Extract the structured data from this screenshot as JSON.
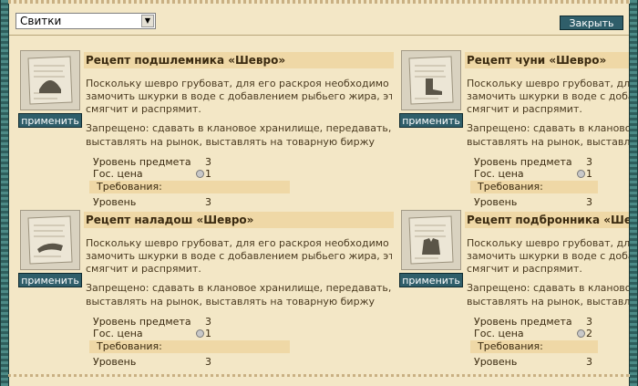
{
  "toolbar": {
    "select_value": "Свитки",
    "close_label": "Закрыть"
  },
  "apply_label": "применить",
  "cards": [
    {
      "title": "Рецепт подшлемника «Шевро»",
      "desc": [
        "Поскольку шевро грубоват, для его раскроя необходимо заранее",
        "замочить шкурки в воде с добавлением рыбьего жира, это их",
        "смягчит и распрямит."
      ],
      "forbid": [
        "Запрещено: сдавать в клановое хранилище, передавать,",
        "выставлять на рынок, выставлять на товарную биржу"
      ],
      "item_level_label": "Уровень предмета",
      "item_level": "3",
      "price_label": "Гос. цена",
      "price": "1",
      "req_label": "Требования:",
      "level_label": "Уровень",
      "level": "3",
      "icon": "helmet-icon"
    },
    {
      "title": "Рецепт чуни «Шевро»",
      "desc": [
        "Поскольку шевро грубоват, для его раскроя необходимо заранее",
        "замочить шкурки в воде с добавлением рыбьего жира, это их",
        "смягчит и распрямит."
      ],
      "forbid": [
        "Запрещено: сдавать в клановое хранилище, передавать,",
        "выставлять на рынок, выставлять на товарную биржу"
      ],
      "item_level_label": "Уровень предмета",
      "item_level": "3",
      "price_label": "Гос. цена",
      "price": "1",
      "req_label": "Требования:",
      "level_label": "Уровень",
      "level": "3",
      "icon": "boot-icon"
    },
    {
      "title": "Рецепт наладош «Шевро»",
      "desc": [
        "Поскольку шевро грубоват, для его раскроя необходимо заранее",
        "замочить шкурки в воде с добавлением рыбьего жира, это их",
        "смягчит и распрямит."
      ],
      "forbid": [
        "Запрещено: сдавать в клановое хранилище, передавать,",
        "выставлять на рынок, выставлять на товарную биржу"
      ],
      "item_level_label": "Уровень предмета",
      "item_level": "3",
      "price_label": "Гос. цена",
      "price": "1",
      "req_label": "Требования:",
      "level_label": "Уровень",
      "level": "3",
      "icon": "bracer-icon"
    },
    {
      "title": "Рецепт подбронника «Шевро»",
      "desc": [
        "Поскольку шевро грубоват, для его раскроя необходимо заранее",
        "замочить шкурки в воде с добавлением рыбьего жира, это их",
        "смягчит и распрямит."
      ],
      "forbid": [
        "Запрещено: сдавать в клановое хранилище, передавать,",
        "выставлять на рынок, выставлять на товарную биржу"
      ],
      "item_level_label": "Уровень предмета",
      "item_level": "3",
      "price_label": "Гос. цена",
      "price": "2",
      "req_label": "Требования:",
      "level_label": "Уровень",
      "level": "3",
      "icon": "vest-icon"
    }
  ]
}
